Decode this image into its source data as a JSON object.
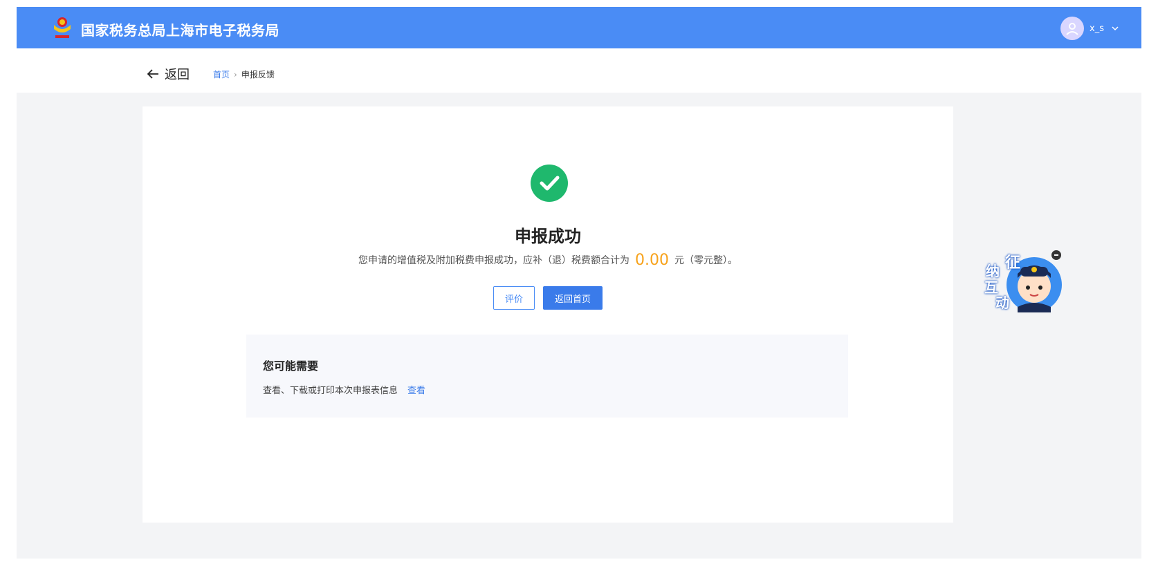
{
  "header": {
    "site_title": "国家税务总局上海市电子税务局",
    "username": "x_s"
  },
  "nav": {
    "back_label": "返回",
    "breadcrumb": {
      "home": "首页",
      "separator": "›",
      "current": "申报反馈"
    }
  },
  "result": {
    "title": "申报成功",
    "message_prefix": "您申请的增值税及附加税费申报成功，应补（退）税费额合计为",
    "amount": "0.00",
    "message_suffix": "元（零元整）。",
    "amount_color": "#f7a21a",
    "success_color": "#1fb86d"
  },
  "actions": {
    "evaluate_label": "评价",
    "home_label": "返回首页"
  },
  "maybe_need": {
    "title": "您可能需要",
    "description": "查看、下载或打印本次申报表信息",
    "link": "查看"
  },
  "widget": {
    "chars": [
      "纳",
      "征",
      "互",
      "动"
    ]
  },
  "colors": {
    "header_bg": "#4a8cf5",
    "primary": "#3a7bea"
  }
}
